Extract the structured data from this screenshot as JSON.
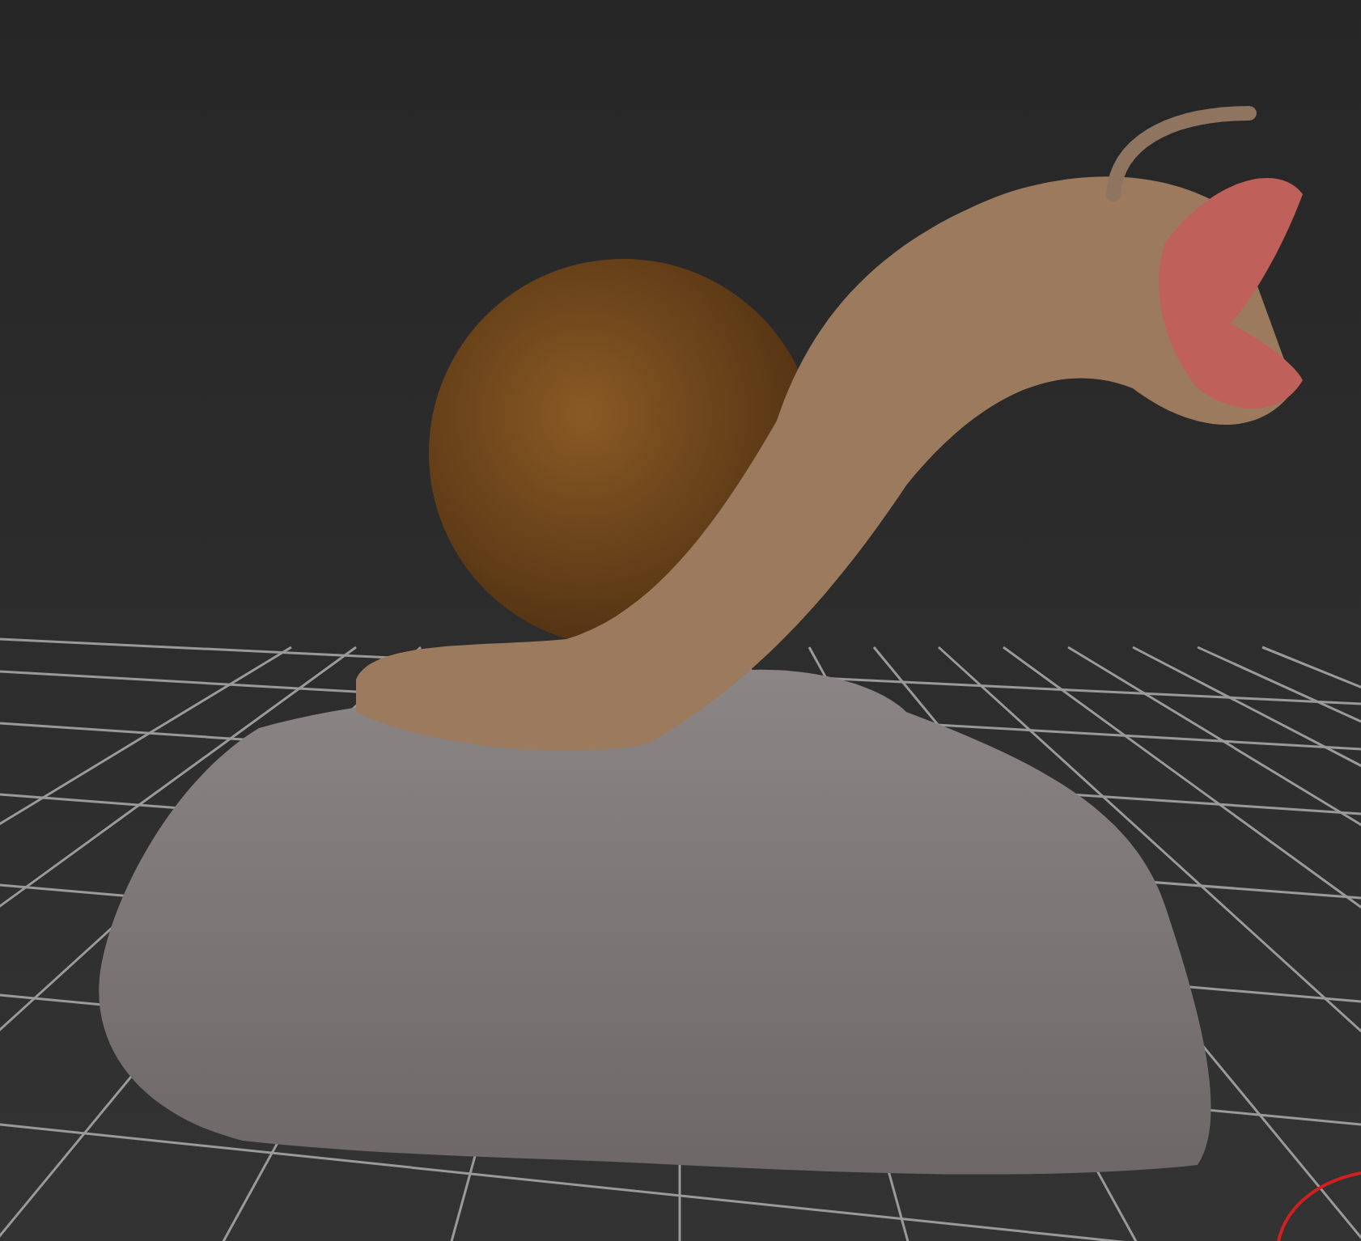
{
  "viewport": {
    "show_grid": true,
    "show_gizmo": true
  }
}
